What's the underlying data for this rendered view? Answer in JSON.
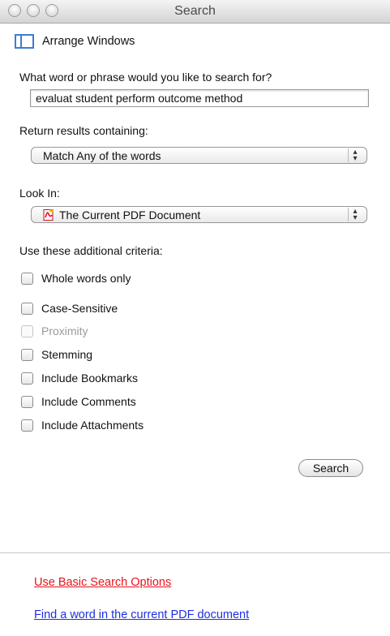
{
  "window": {
    "title": "Search"
  },
  "arrange": {
    "label": "Arrange Windows"
  },
  "query": {
    "prompt": "What word or phrase would you like to search for?",
    "value": "evaluat student perform outcome method"
  },
  "return_results": {
    "label": "Return results containing:",
    "selected": "Match Any of the words"
  },
  "look_in": {
    "label": "Look In:",
    "selected": "The Current PDF Document"
  },
  "criteria": {
    "label": "Use these additional criteria:",
    "items": [
      {
        "label": "Whole words only",
        "checked": false,
        "enabled": true
      },
      {
        "label": "Case-Sensitive",
        "checked": false,
        "enabled": true
      },
      {
        "label": "Proximity",
        "checked": false,
        "enabled": false
      },
      {
        "label": "Stemming",
        "checked": false,
        "enabled": true
      },
      {
        "label": "Include Bookmarks",
        "checked": false,
        "enabled": true
      },
      {
        "label": "Include Comments",
        "checked": false,
        "enabled": true
      },
      {
        "label": "Include Attachments",
        "checked": false,
        "enabled": true
      }
    ]
  },
  "search_button": {
    "label": "Search"
  },
  "links": {
    "basic": "Use Basic Search Options",
    "find": "Find a word in the current PDF document"
  },
  "colors": {
    "link_basic": "#e8121b",
    "link_find": "#1e2fe0",
    "accent": "#3d7bd8"
  }
}
